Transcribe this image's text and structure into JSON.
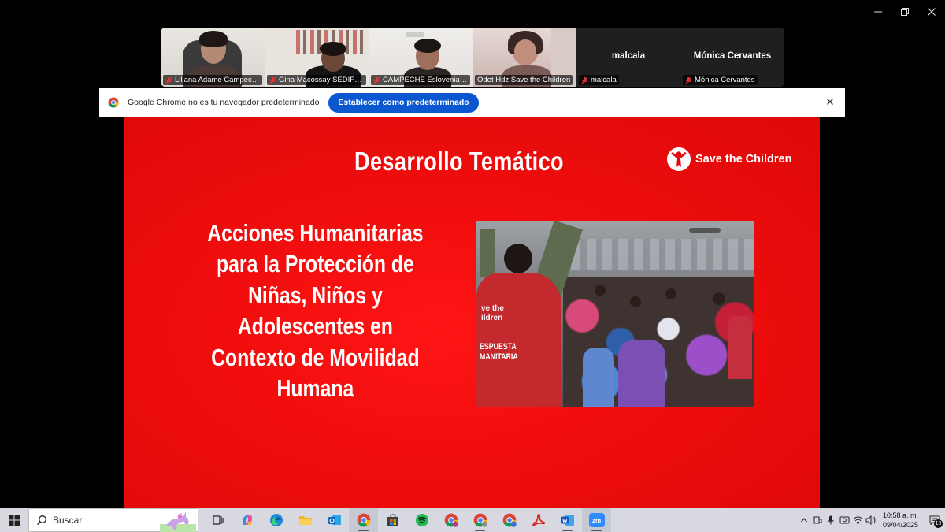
{
  "participants": [
    {
      "name": "Liliana Adame Campeche",
      "video": true
    },
    {
      "name": "Gina Macossay SEDIF Yu...",
      "video": true
    },
    {
      "name": "CAMPECHE Eslovenia G...",
      "video": true
    },
    {
      "name": "Odet Hdz Save the Children",
      "video": true,
      "active": true
    },
    {
      "name": "malcala",
      "center_name": "malcala",
      "video": false
    },
    {
      "name": "Mónica Cervantes",
      "center_name": "Mónica Cervantes",
      "video": false
    }
  ],
  "chrome_infobar": {
    "message": "Google Chrome no es tu navegador predeterminado",
    "button": "Establecer como predeterminado"
  },
  "slide": {
    "title": "Desarrollo Temático",
    "logo_text": "Save the Children",
    "body": "Acciones Humanitarias para la Protección de Niñas, Niños y Adolescentes en Contexto de Movilidad Humana",
    "photo_vest_text_1": "ve the",
    "photo_vest_text_2": "ildren",
    "photo_vest_text_3": "ESPUESTA",
    "photo_vest_text_4": "MANITARIA"
  },
  "taskbar": {
    "search_placeholder": "Buscar",
    "time": "10:58 a. m.",
    "date": "09/04/2025",
    "notification_count": "10",
    "zoom_label": "zm",
    "apps": [
      "task-view",
      "copilot",
      "edge",
      "file-explorer",
      "outlook",
      "chrome",
      "store",
      "spotify",
      "chrome-profile-2",
      "chrome-profile-3",
      "chrome-profile-4",
      "acrobat",
      "word",
      "zoom"
    ]
  },
  "colors": {
    "slide_red": "#f00d0d",
    "chrome_button": "#0b57d0",
    "active_speaker": "#3bd16f",
    "taskbar": "#d8d9e0"
  }
}
